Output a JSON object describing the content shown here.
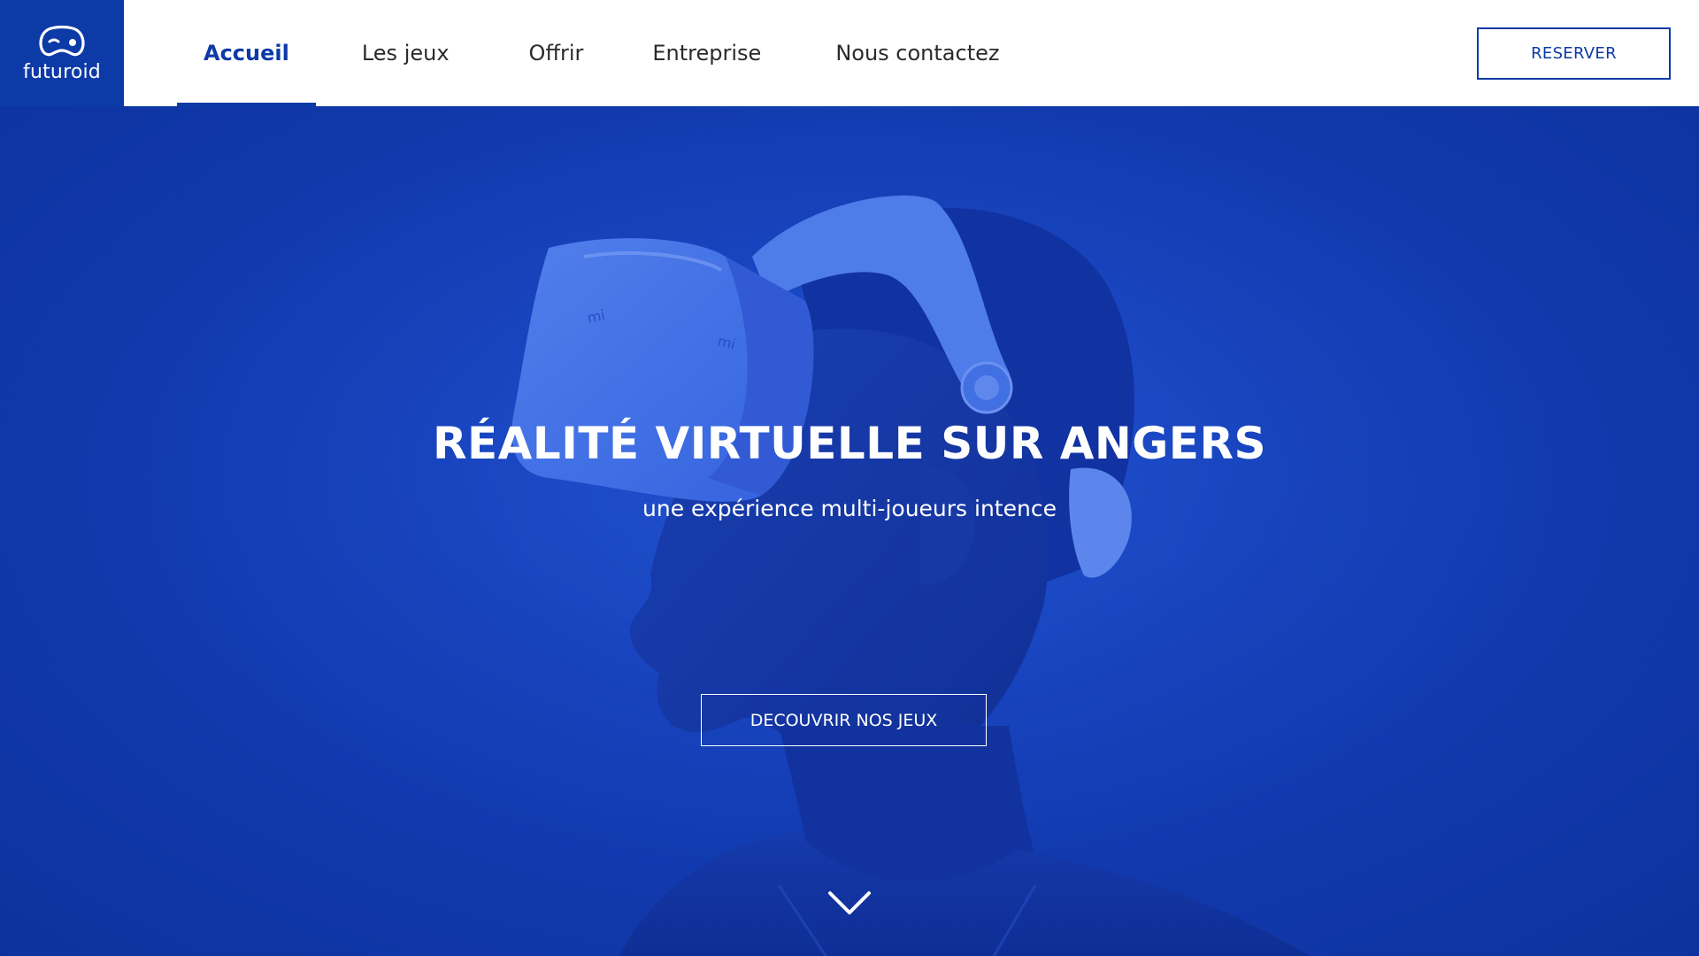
{
  "brand": {
    "name": "futuroid",
    "color": "#0c3aa6"
  },
  "nav": {
    "items": [
      {
        "label": "Accueil",
        "active": true
      },
      {
        "label": "Les jeux",
        "active": false
      },
      {
        "label": "Offrir",
        "active": false
      },
      {
        "label": "Entreprise",
        "active": false
      },
      {
        "label": "Nous contactez",
        "active": false
      }
    ]
  },
  "header": {
    "reserve_label": "RESERVER"
  },
  "hero": {
    "title": "RÉALITÉ VIRTUELLE SUR ANGERS",
    "subtitle": "une expérience multi-joueurs intence",
    "cta_label": "DECOUVRIR NOS JEUX",
    "background_color": "#1745c2",
    "scroll_icon": "chevron-down-icon"
  }
}
